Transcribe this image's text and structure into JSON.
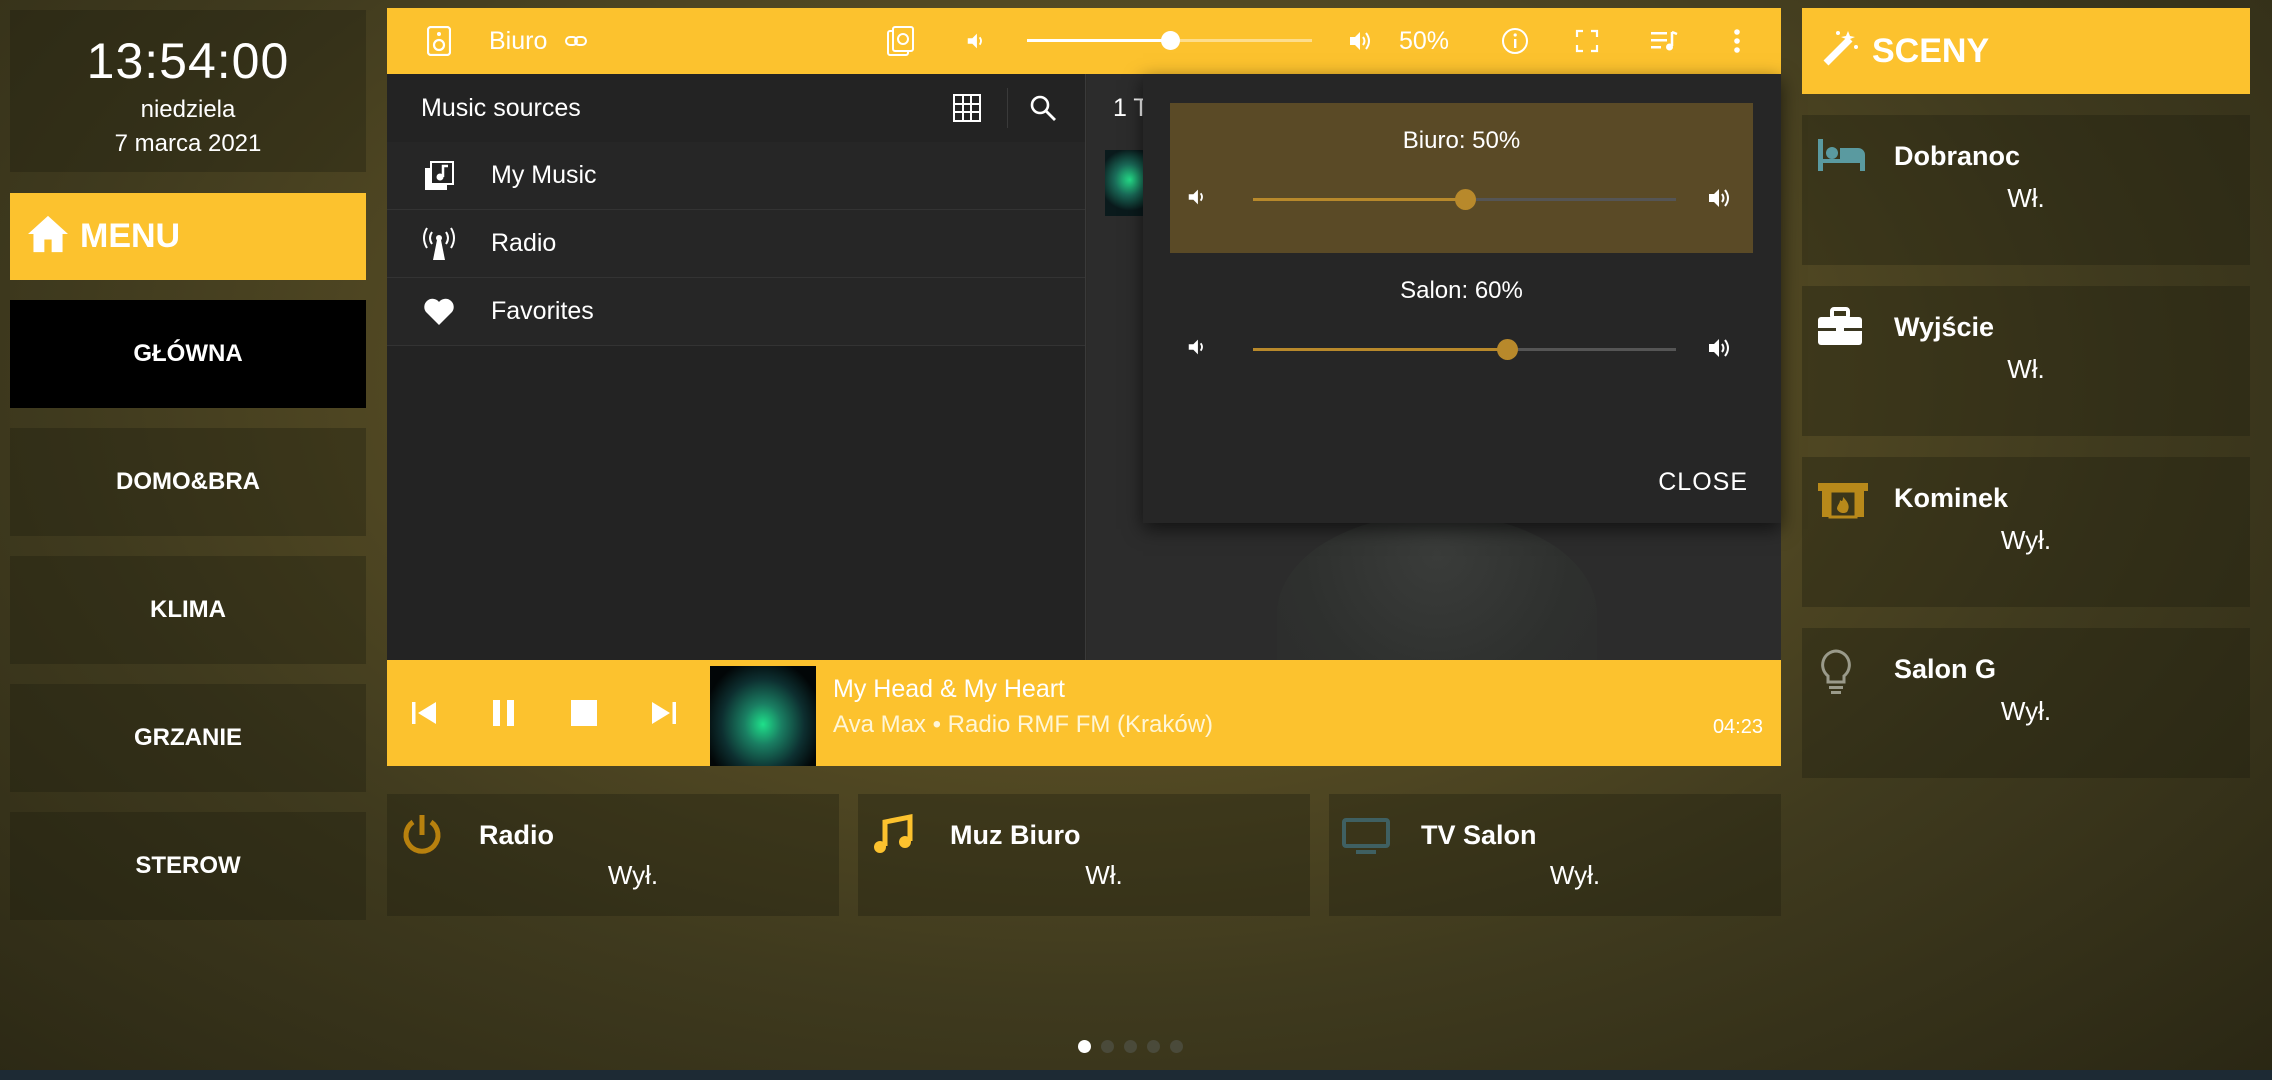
{
  "clock": {
    "time": "13:54:00",
    "day": "niedziela",
    "date": "7 marca 2021"
  },
  "menu": {
    "title": "MENU",
    "items": [
      {
        "label": "GŁÓWNA",
        "active": true
      },
      {
        "label": "DOMO&BRA"
      },
      {
        "label": "KLIMA"
      },
      {
        "label": "GRZANIE"
      },
      {
        "label": "STEROW"
      }
    ]
  },
  "player": {
    "name": "Biuro",
    "volume_percent": 50,
    "volume_label": "50%",
    "sources": {
      "title": "Music sources",
      "items": [
        {
          "label": "My Music",
          "icon": "music-library-icon"
        },
        {
          "label": "Radio",
          "icon": "radio-tower-icon"
        },
        {
          "label": "Favorites",
          "icon": "heart-icon"
        }
      ]
    },
    "right_pane_heading": "1 T",
    "group_volume": {
      "rows": [
        {
          "label": "Biuro: 50%",
          "value": 50
        },
        {
          "label": "Salon: 60%",
          "value": 60
        }
      ],
      "close_label": "CLOSE"
    },
    "now_playing": {
      "title": "My Head & My Heart",
      "subtitle": "Ava Max • Radio RMF FM (Kraków)",
      "time": "04:23"
    },
    "colors": {
      "accent": "#fcc22e",
      "slider": "#b8892b"
    }
  },
  "entities": [
    {
      "name": "Radio",
      "state": "Wył.",
      "icon": "power-icon",
      "color": "#b8810e"
    },
    {
      "name": "Muz Biuro",
      "state": "Wł.",
      "icon": "music-note-icon",
      "color": "#fcc22e"
    },
    {
      "name": "TV Salon",
      "state": "Wył.",
      "icon": "monitor-icon",
      "color": "#3f6062"
    }
  ],
  "scenes": {
    "title": "SCENY",
    "items": [
      {
        "name": "Dobranoc",
        "state": "Wł.",
        "icon": "bed-icon"
      },
      {
        "name": "Wyjście",
        "state": "Wł.",
        "icon": "briefcase-icon"
      },
      {
        "name": "Kominek",
        "state": "Wył.",
        "icon": "fireplace-icon"
      },
      {
        "name": "Salon G",
        "state": "Wył.",
        "icon": "lightbulb-icon"
      }
    ]
  },
  "pagination": {
    "pages": 5,
    "active": 1
  }
}
